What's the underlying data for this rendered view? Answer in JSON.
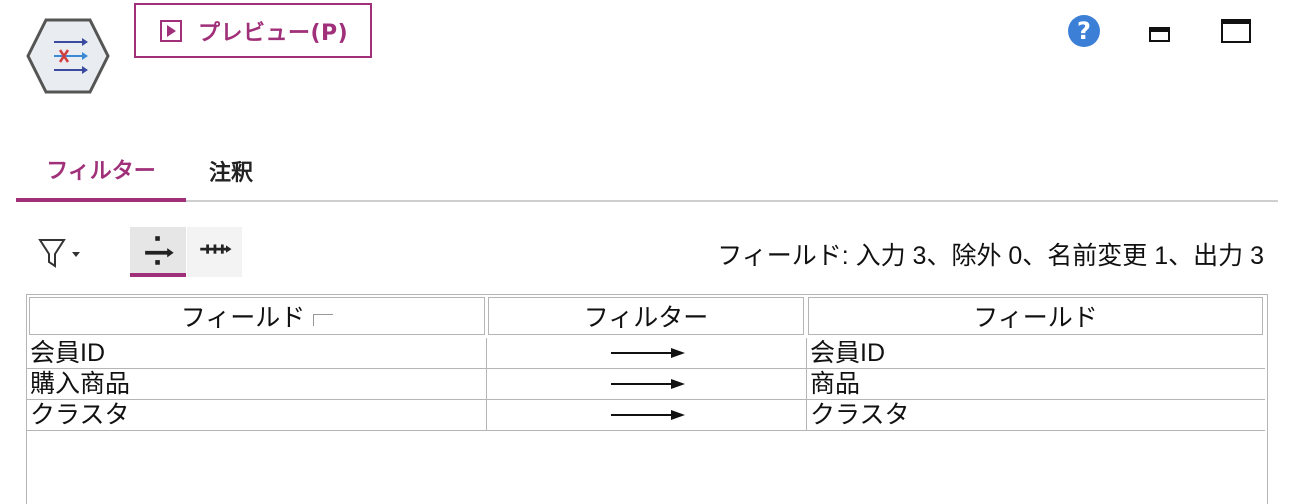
{
  "toolbar": {
    "preview_label": "プレビュー(P)",
    "help_glyph": "?"
  },
  "tabs": [
    {
      "label": "フィルター",
      "active": true
    },
    {
      "label": "注釈",
      "active": false
    }
  ],
  "summary": "フィールド: 入力 3、除外 0、名前変更 1、出力 3",
  "table": {
    "headers": [
      "フィールド",
      "フィルター",
      "フィールド"
    ],
    "rows": [
      {
        "input": "会員ID",
        "filter": "pass",
        "output": "会員ID"
      },
      {
        "input": "購入商品",
        "filter": "pass",
        "output": "商品"
      },
      {
        "input": "クラスタ",
        "filter": "pass",
        "output": "クラスタ"
      }
    ]
  },
  "colors": {
    "accent": "#a0307a",
    "help": "#3b7fd6"
  },
  "icons": [
    "filter-node-icon",
    "play-icon",
    "help-icon",
    "minimize-icon",
    "maximize-icon",
    "funnel-icon",
    "pass-through-mode-icon",
    "discard-mode-icon",
    "sort-indicator-icon",
    "pass-arrow-icon"
  ]
}
